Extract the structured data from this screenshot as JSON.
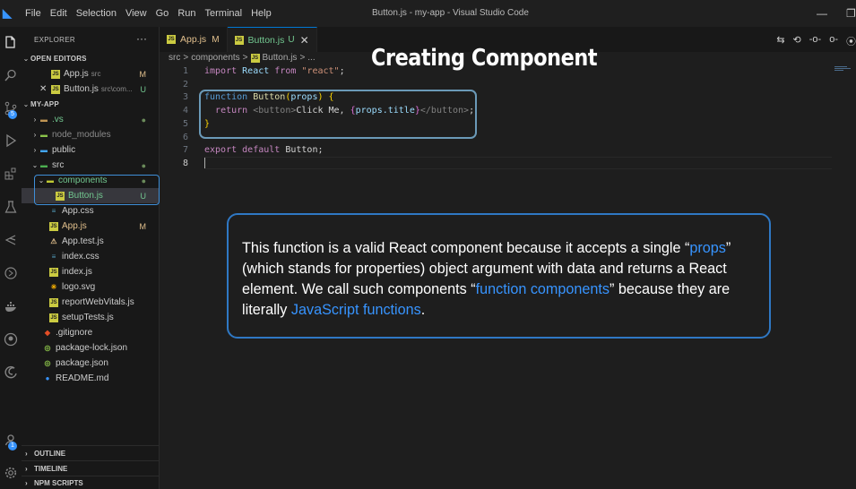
{
  "window": {
    "menu": [
      "File",
      "Edit",
      "Selection",
      "View",
      "Go",
      "Run",
      "Terminal",
      "Help"
    ],
    "title": "Button.js - my-app - Visual Studio Code",
    "controls": {
      "minimize": "—",
      "restore": "❐"
    }
  },
  "explorer": {
    "header": "EXPLORER",
    "more": "···",
    "open_editors_label": "OPEN EDITORS",
    "open_editors": [
      {
        "name": "App.js",
        "path": "src",
        "status": "M",
        "close": ""
      },
      {
        "name": "Button.js",
        "path": "src\\com...",
        "status": "U",
        "close": "✕"
      }
    ],
    "project_label": "MY-APP",
    "tree": [
      {
        "name": ".vs",
        "kind": "folder-closed",
        "status": "●"
      },
      {
        "name": "node_modules",
        "kind": "folder-closed",
        "status": ""
      },
      {
        "name": "public",
        "kind": "folder-closed",
        "status": ""
      },
      {
        "name": "src",
        "kind": "folder-open",
        "status": "●"
      },
      {
        "name": "components",
        "kind": "folder-open",
        "status": "●"
      },
      {
        "name": "Button.js",
        "kind": "js",
        "status": "U"
      },
      {
        "name": "App.css",
        "kind": "css",
        "status": ""
      },
      {
        "name": "App.js",
        "kind": "js",
        "status": "M"
      },
      {
        "name": "App.test.js",
        "kind": "test",
        "status": ""
      },
      {
        "name": "index.css",
        "kind": "css",
        "status": ""
      },
      {
        "name": "index.js",
        "kind": "js",
        "status": ""
      },
      {
        "name": "logo.svg",
        "kind": "svg",
        "status": ""
      },
      {
        "name": "reportWebVitals.js",
        "kind": "js",
        "status": ""
      },
      {
        "name": "setupTests.js",
        "kind": "js",
        "status": ""
      },
      {
        "name": ".gitignore",
        "kind": "git",
        "status": ""
      },
      {
        "name": "package-lock.json",
        "kind": "json",
        "status": ""
      },
      {
        "name": "package.json",
        "kind": "json",
        "status": ""
      },
      {
        "name": "README.md",
        "kind": "info",
        "status": ""
      }
    ],
    "panels": [
      "OUTLINE",
      "TIMELINE",
      "NPM SCRIPTS"
    ]
  },
  "activity_badges": {
    "source_control": "5",
    "accounts": "1"
  },
  "tabs": [
    {
      "name": "App.js",
      "status": "M",
      "active": false
    },
    {
      "name": "Button.js",
      "status": "U",
      "active": true,
      "close": "✕"
    }
  ],
  "breadcrumb": {
    "parts": [
      "src",
      "components",
      "Button.js",
      "..."
    ],
    "sep": ">"
  },
  "slide_title": "Creating Component",
  "code": {
    "line_numbers": [
      "1",
      "2",
      "3",
      "4",
      "5",
      "6",
      "7",
      "8"
    ],
    "l1": {
      "import": "import",
      "react": "React",
      "from": "from",
      "str": "\"react\"",
      "semi": ";"
    },
    "l3": {
      "function": "function",
      "name": "Button",
      "open": "(",
      "param": "props",
      "close": ")",
      "brace": " {"
    },
    "l4": {
      "return": "return",
      "open_tag": "<button>",
      "text": "Click Me, ",
      "expr_open": "{",
      "expr": "props.title",
      "expr_close": "}",
      "close_tag": "</button>",
      "semi": ";"
    },
    "l5": {
      "brace": "}"
    },
    "l7": {
      "export": "export",
      "default": "default",
      "name": "Button",
      "semi": ";"
    }
  },
  "callout": {
    "p1": "This function is a valid React component because it accepts a single “",
    "props": "props",
    "p2": "” (which stands for properties) object argument with data and returns a React element. We call such components “",
    "function_components": "function components",
    "p3": "” because they are literally ",
    "js_functions": "JavaScript functions",
    "p4": "."
  }
}
